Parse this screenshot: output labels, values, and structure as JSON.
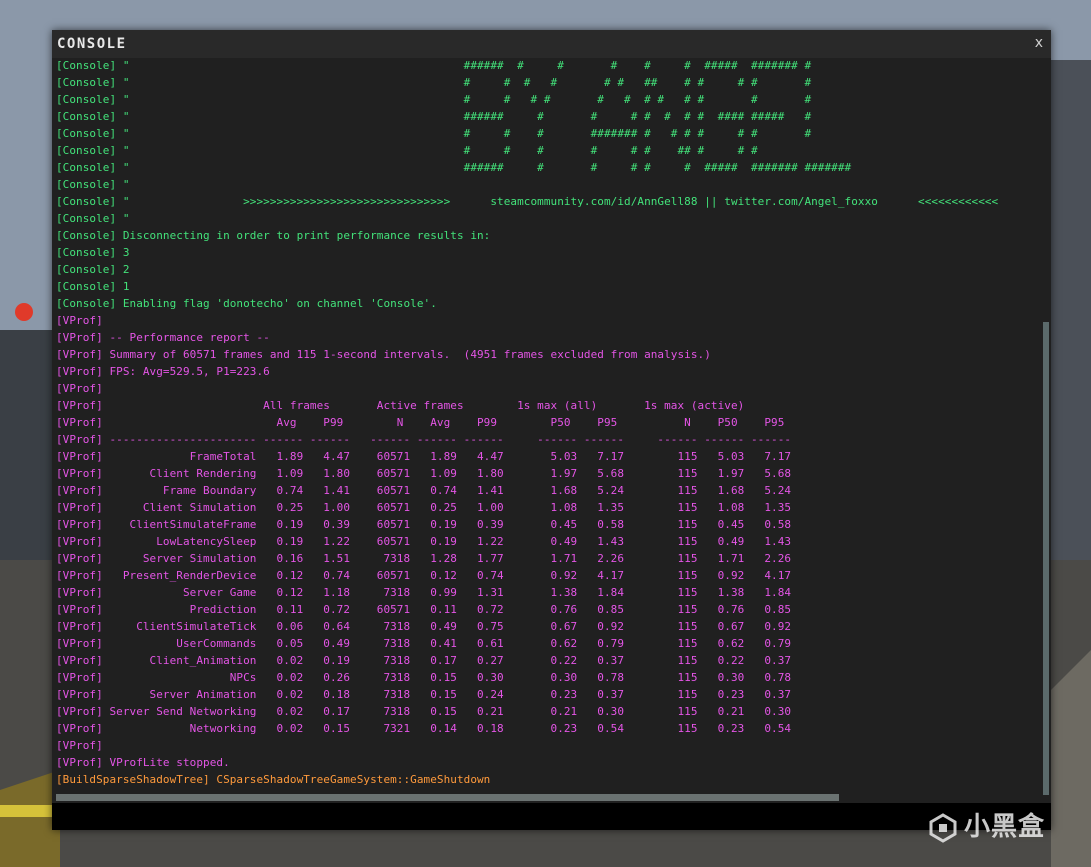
{
  "window": {
    "title": "CONSOLE",
    "close_label": "x"
  },
  "watermark": "小黑盒",
  "colors": {
    "console": "#43e27a",
    "vprof": "#e455e6",
    "build": "#ff9a3c",
    "background": "#202020"
  },
  "log": [
    {
      "channel": "console",
      "text": "[Console] \"                                                  ######  #     #       #    #     #  #####  ####### #"
    },
    {
      "channel": "console",
      "text": "[Console] \"                                                  #     #  #   #       # #   ##    # #     # #       #"
    },
    {
      "channel": "console",
      "text": "[Console] \"                                                  #     #   # #       #   #  # #   # #       #       #"
    },
    {
      "channel": "console",
      "text": "[Console] \"                                                  ######     #       #     # #  #  # #  #### #####   #"
    },
    {
      "channel": "console",
      "text": "[Console] \"                                                  #     #    #       ####### #   # # #     # #       #"
    },
    {
      "channel": "console",
      "text": "[Console] \"                                                  #     #    #       #     # #    ## #     # #"
    },
    {
      "channel": "console",
      "text": "[Console] \"                                                  ######     #       #     # #     #  #####  ####### #######"
    },
    {
      "channel": "console",
      "text": "[Console] \""
    },
    {
      "channel": "console",
      "text": "[Console] \"                 >>>>>>>>>>>>>>>>>>>>>>>>>>>>>>>      steamcommunity.com/id/AnnGell88 || twitter.com/Angel_foxxo      <<<<<<<<<<<<"
    },
    {
      "channel": "console",
      "text": "[Console] \""
    },
    {
      "channel": "console",
      "text": "[Console] Disconnecting in order to print performance results in:"
    },
    {
      "channel": "console",
      "text": "[Console] 3"
    },
    {
      "channel": "console",
      "text": "[Console] 2"
    },
    {
      "channel": "console",
      "text": "[Console] 1"
    },
    {
      "channel": "console",
      "text": "[Console] Enabling flag 'donotecho' on channel 'Console'."
    },
    {
      "channel": "vprof",
      "text": "[VProf]"
    },
    {
      "channel": "vprof",
      "text": "[VProf] -- Performance report --"
    },
    {
      "channel": "vprof",
      "text": "[VProf] Summary of 60571 frames and 115 1-second intervals.  (4951 frames excluded from analysis.)"
    },
    {
      "channel": "vprof",
      "text": "[VProf] FPS: Avg=529.5, P1=223.6"
    },
    {
      "channel": "vprof",
      "text": "[VProf]"
    },
    {
      "channel": "vprof",
      "text": "[VProf]                        All frames       Active frames        1s max (all)       1s max (active)"
    },
    {
      "channel": "vprof",
      "text": "[VProf]                          Avg    P99        N    Avg    P99        P50    P95          N    P50    P95"
    },
    {
      "channel": "vprof",
      "text": "[VProf] ---------------------- ------ ------   ------ ------ ------     ------ ------     ------ ------ ------"
    },
    {
      "channel": "vprof",
      "text": "[VProf]             FrameTotal   1.89   4.47    60571   1.89   4.47       5.03   7.17        115   5.03   7.17"
    },
    {
      "channel": "vprof",
      "text": "[VProf]       Client Rendering   1.09   1.80    60571   1.09   1.80       1.97   5.68        115   1.97   5.68"
    },
    {
      "channel": "vprof",
      "text": "[VProf]         Frame Boundary   0.74   1.41    60571   0.74   1.41       1.68   5.24        115   1.68   5.24"
    },
    {
      "channel": "vprof",
      "text": "[VProf]      Client Simulation   0.25   1.00    60571   0.25   1.00       1.08   1.35        115   1.08   1.35"
    },
    {
      "channel": "vprof",
      "text": "[VProf]    ClientSimulateFrame   0.19   0.39    60571   0.19   0.39       0.45   0.58        115   0.45   0.58"
    },
    {
      "channel": "vprof",
      "text": "[VProf]        LowLatencySleep   0.19   1.22    60571   0.19   1.22       0.49   1.43        115   0.49   1.43"
    },
    {
      "channel": "vprof",
      "text": "[VProf]      Server Simulation   0.16   1.51     7318   1.28   1.77       1.71   2.26        115   1.71   2.26"
    },
    {
      "channel": "vprof",
      "text": "[VProf]   Present_RenderDevice   0.12   0.74    60571   0.12   0.74       0.92   4.17        115   0.92   4.17"
    },
    {
      "channel": "vprof",
      "text": "[VProf]            Server Game   0.12   1.18     7318   0.99   1.31       1.38   1.84        115   1.38   1.84"
    },
    {
      "channel": "vprof",
      "text": "[VProf]             Prediction   0.11   0.72    60571   0.11   0.72       0.76   0.85        115   0.76   0.85"
    },
    {
      "channel": "vprof",
      "text": "[VProf]     ClientSimulateTick   0.06   0.64     7318   0.49   0.75       0.67   0.92        115   0.67   0.92"
    },
    {
      "channel": "vprof",
      "text": "[VProf]           UserCommands   0.05   0.49     7318   0.41   0.61       0.62   0.79        115   0.62   0.79"
    },
    {
      "channel": "vprof",
      "text": "[VProf]       Client_Animation   0.02   0.19     7318   0.17   0.27       0.22   0.37        115   0.22   0.37"
    },
    {
      "channel": "vprof",
      "text": "[VProf]                   NPCs   0.02   0.26     7318   0.15   0.30       0.30   0.78        115   0.30   0.78"
    },
    {
      "channel": "vprof",
      "text": "[VProf]       Server Animation   0.02   0.18     7318   0.15   0.24       0.23   0.37        115   0.23   0.37"
    },
    {
      "channel": "vprof",
      "text": "[VProf] Server Send Networking   0.02   0.17     7318   0.15   0.21       0.21   0.30        115   0.21   0.30"
    },
    {
      "channel": "vprof",
      "text": "[VProf]             Networking   0.02   0.15     7321   0.14   0.18       0.23   0.54        115   0.23   0.54"
    },
    {
      "channel": "vprof",
      "text": "[VProf]"
    },
    {
      "channel": "vprof",
      "text": "[VProf] VProfLite stopped."
    },
    {
      "channel": "build",
      "text": "[BuildSparseShadowTree] CSparseShadowTreeGameSystem::GameShutdown"
    }
  ]
}
